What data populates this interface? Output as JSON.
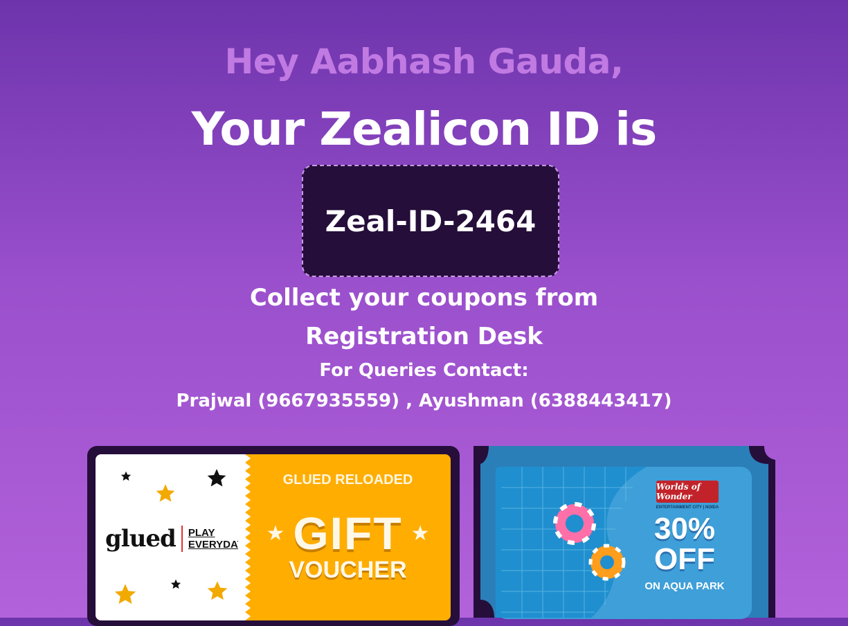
{
  "greeting": "Hey Aabhash Gauda,",
  "id_heading": "Your Zealicon ID is",
  "zeal_id": "Zeal-ID-2464",
  "collect": {
    "line1": "Collect your coupons from",
    "line2": "Registration Desk"
  },
  "queries": {
    "label": "For Queries Contact:",
    "contacts": "Prajwal (9667935559) , Ayushman (6388443417)"
  },
  "coupons": [
    {
      "brand": "glued",
      "tagline_line1": "PLAY",
      "tagline_line2": "EVERYDAY",
      "header": "GLUED RELOADED",
      "title": "GIFT",
      "subtitle": "VOUCHER",
      "accent": "#ffad00"
    },
    {
      "brand": "Worlds of Wonder",
      "brand_sub": "ENTERTAINMENT CITY | NOIDA",
      "discount": "30%",
      "off": "OFF",
      "detail": "ON AQUA PARK",
      "accent": "#3f9fd8"
    }
  ],
  "colors": {
    "background_top": "#6d34ac",
    "background_bottom": "#b262da",
    "greeting": "#c07ae2",
    "id_box": "#250e3a"
  }
}
